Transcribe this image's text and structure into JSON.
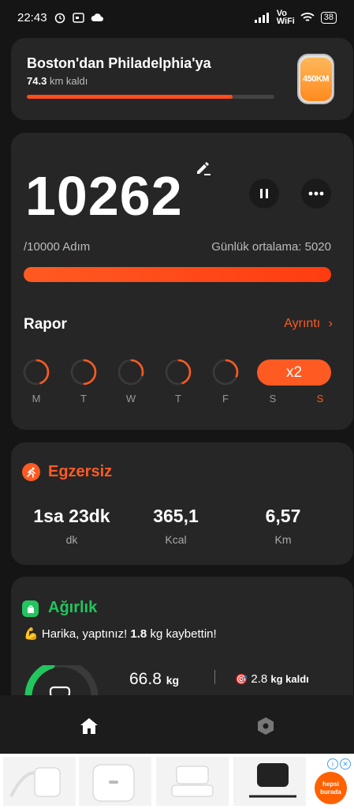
{
  "status_bar": {
    "time": "22:43",
    "network": "Vo WiFi",
    "battery": "38"
  },
  "route": {
    "title": "Boston'dan Philadelphia'ya",
    "remaining_value": "74.3",
    "remaining_label": "km kaldı",
    "progress_fraction": 0.83,
    "medal_label": "450KM"
  },
  "steps": {
    "count": "10262",
    "goal": "/10000 Adım",
    "average": "Günlük ortalama: 5020",
    "progress_fraction": 1.0,
    "report_title": "Rapor",
    "details_link": "Ayrıntı",
    "days": [
      {
        "label": "M",
        "fraction": 0.45,
        "active": false
      },
      {
        "label": "T",
        "fraction": 0.5,
        "active": false
      },
      {
        "label": "W",
        "fraction": 0.3,
        "active": false
      },
      {
        "label": "T",
        "fraction": 0.45,
        "active": false
      },
      {
        "label": "F",
        "fraction": 0.32,
        "active": false
      },
      {
        "label": "S",
        "fraction": 0,
        "active": false
      },
      {
        "label": "S",
        "fraction": 1.0,
        "active": true
      }
    ],
    "multiplier": "x2"
  },
  "exercise": {
    "title": "Egzersiz",
    "stats": [
      {
        "value": "1sa 23dk",
        "unit": "dk"
      },
      {
        "value": "365,1",
        "unit": "Kcal"
      },
      {
        "value": "6,57",
        "unit": "Km"
      }
    ]
  },
  "weight": {
    "title": "Ağırlık",
    "message_prefix": "Harika, yaptınız!",
    "message_value": "1.8",
    "message_suffix": "kg kaybettin!",
    "current_value": "66.8",
    "current_unit": "kg",
    "remaining_value": "2.8",
    "remaining_unit": "kg kaldı",
    "progress_fraction": 0.4
  },
  "colors": {
    "accent": "#ff5a22",
    "weight_green": "#22c55e",
    "card": "#262626",
    "background": "#151515"
  },
  "nav": {
    "items": [
      "home-icon",
      "settings-icon"
    ]
  }
}
